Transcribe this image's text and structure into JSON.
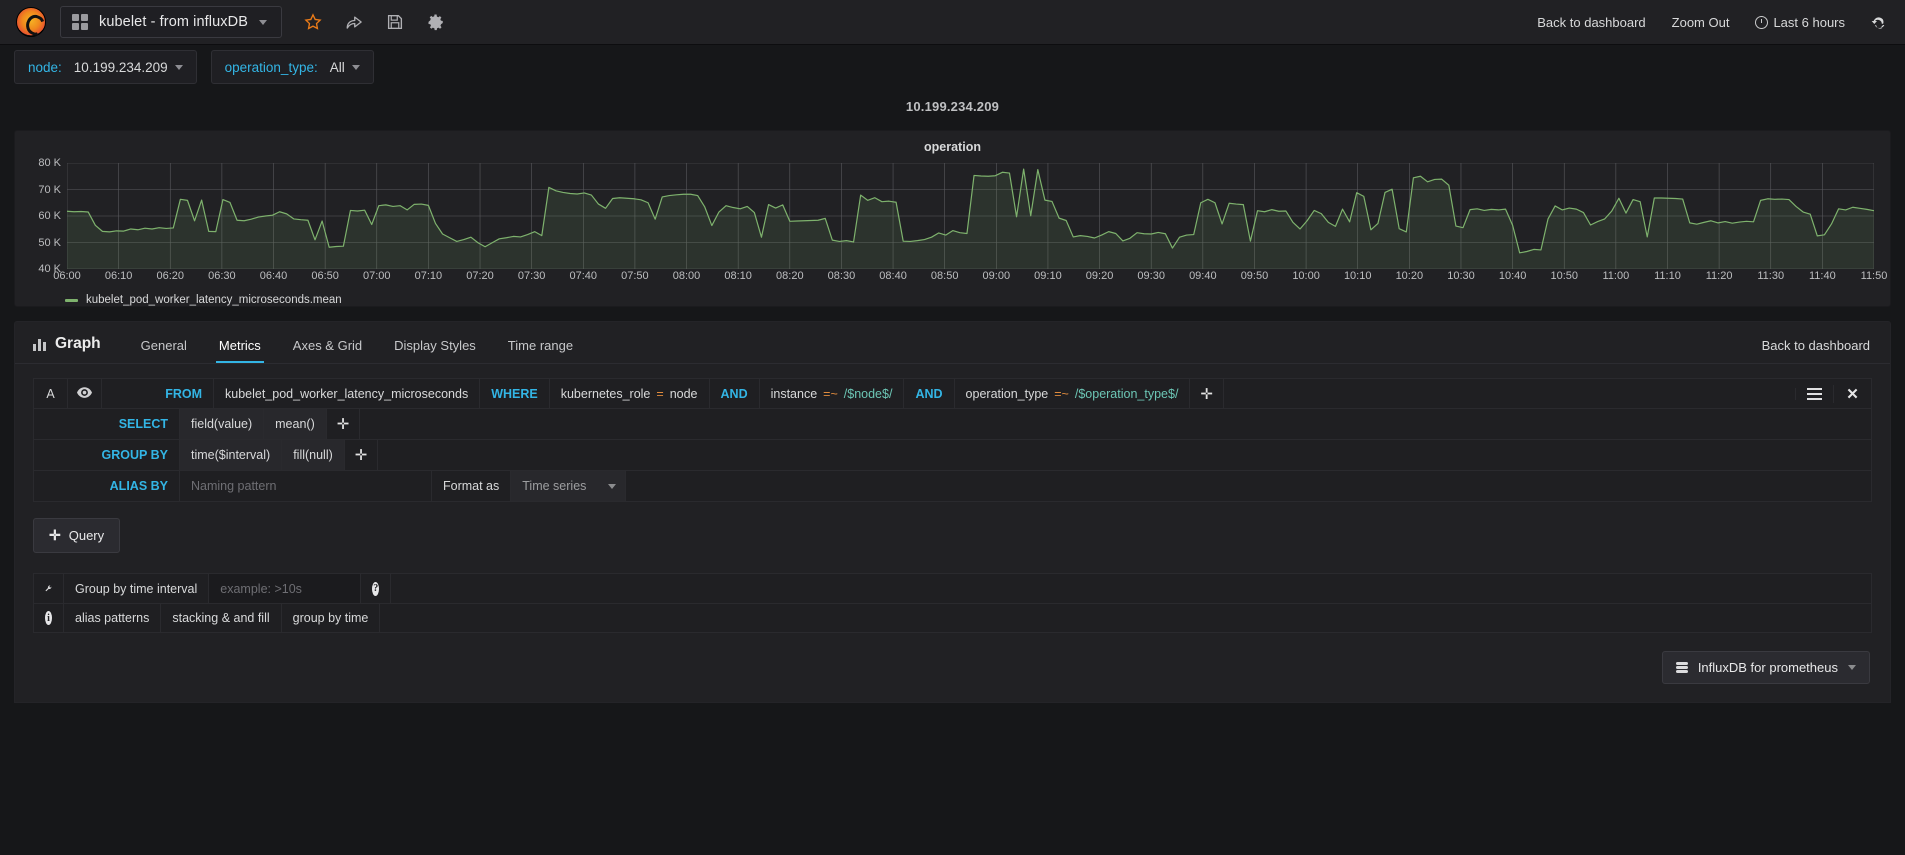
{
  "navbar": {
    "logo_icon": "grafana-logo-icon",
    "grid_icon": "grid-icon",
    "dashboard_title": "kubelet - from influxDB",
    "caret_icon": "chevron-down-icon",
    "icons": [
      {
        "name": "star-icon",
        "title": "Mark as favorite"
      },
      {
        "name": "share-icon",
        "title": "Share dashboard"
      },
      {
        "name": "save-icon",
        "title": "Save dashboard"
      },
      {
        "name": "gear-icon",
        "title": "Dashboard settings"
      }
    ],
    "back_to_dashboard": "Back to dashboard",
    "zoom_out": "Zoom Out",
    "time_range": "Last 6 hours",
    "clock_icon": "clock-icon",
    "refresh_icon": "refresh-icon"
  },
  "template_vars": [
    {
      "label": "node:",
      "value": "10.199.234.209",
      "caret_icon": "chevron-down-icon"
    },
    {
      "label": "operation_type:",
      "value": "All",
      "caret_icon": "chevron-down-icon"
    }
  ],
  "row_title": "10.199.234.209",
  "chart_data": {
    "type": "line",
    "title": "operation",
    "xlabel": "",
    "ylabel": "",
    "ylim": [
      40000,
      80000
    ],
    "grid": true,
    "legend_position": "bottom-left",
    "y_ticks": [
      "80 K",
      "70 K",
      "60 K",
      "50 K",
      "40 K"
    ],
    "y_tick_values": [
      80000,
      70000,
      60000,
      50000,
      40000
    ],
    "x_ticks": [
      "06:00",
      "06:10",
      "06:20",
      "06:30",
      "06:40",
      "06:50",
      "07:00",
      "07:10",
      "07:20",
      "07:30",
      "07:40",
      "07:50",
      "08:00",
      "08:10",
      "08:20",
      "08:30",
      "08:40",
      "08:50",
      "09:00",
      "09:10",
      "09:20",
      "09:30",
      "09:40",
      "09:50",
      "10:00",
      "10:10",
      "10:20",
      "10:30",
      "10:40",
      "10:50",
      "11:00",
      "11:10",
      "11:20",
      "11:30",
      "11:40",
      "11:50"
    ],
    "series": [
      {
        "name": "kubelet_pod_worker_latency_microseconds.mean",
        "color": "#7eb26d",
        "fill": true,
        "values": [
          61800,
          61600,
          61700,
          61500,
          56500,
          54200,
          54000,
          54400,
          54300,
          55100,
          54800,
          55400,
          55100,
          55600,
          55300,
          55500,
          66300,
          65900,
          58200,
          66000,
          54200,
          54100,
          66200,
          65100,
          58400,
          58200,
          58800,
          59600,
          60000,
          60300,
          61600,
          60800,
          58900,
          58600,
          58400,
          51000,
          58100,
          48200,
          48500,
          48600,
          62100,
          61900,
          62200,
          56800,
          63900,
          64200,
          63600,
          63900,
          62300,
          64400,
          64500,
          64000,
          57200,
          53200,
          51800,
          50400,
          51100,
          52000,
          49900,
          48400,
          49900,
          51400,
          51800,
          52300,
          52100,
          53000,
          54100,
          52600,
          70800,
          69500,
          68900,
          68500,
          68300,
          68700,
          67900,
          64500,
          62900,
          66600,
          66900,
          66700,
          66500,
          66100,
          65000,
          58800,
          67200,
          67700,
          68000,
          68200,
          68200,
          67700,
          63400,
          56400,
          61500,
          63900,
          63200,
          62700,
          63600,
          61300,
          52000,
          64300,
          63000,
          64200,
          58000,
          58100,
          58200,
          58300,
          58400,
          59100,
          50900,
          50400,
          50700,
          50200,
          67900,
          65900,
          66900,
          65400,
          65600,
          65200,
          50500,
          50400,
          50700,
          51100,
          52000,
          53600,
          52800,
          54500,
          53700,
          53400,
          75300,
          75100,
          75000,
          75200,
          76500,
          76200,
          59700,
          77700,
          60100,
          77500,
          66000,
          65500,
          59200,
          58300,
          52100,
          52600,
          52300,
          51700,
          52800,
          54100,
          53400,
          50600,
          51600,
          53700,
          53300,
          53200,
          53800,
          53300,
          47900,
          52000,
          52800,
          53000,
          65000,
          66300,
          65000,
          57000,
          64800,
          64500,
          64300,
          50500,
          62000,
          61600,
          62400,
          61800,
          61900,
          57600,
          55100,
          58200,
          62100,
          60900,
          57600,
          56100,
          62600,
          57800,
          68800,
          67400,
          54800,
          57200,
          68900,
          70100,
          55200,
          54000,
          74400,
          75000,
          72900,
          73800,
          73900,
          71600,
          56200,
          55600,
          62400,
          62700,
          62100,
          62500,
          62300,
          62600,
          56500,
          46100,
          46600,
          47400,
          47200,
          58900,
          63800,
          62300,
          63000,
          62600,
          61300,
          56600,
          57900,
          58900,
          61900,
          66700,
          61100,
          66200,
          65400,
          52100,
          66800,
          66800,
          66700,
          66600,
          66400,
          57400,
          56900,
          57600,
          58200,
          57400,
          57900,
          57300,
          57700,
          58000,
          57800,
          65900,
          66500,
          66300,
          66400,
          66200,
          63600,
          61500,
          60700,
          52500,
          52900,
          57000,
          62700,
          62300,
          63300,
          62900,
          62500,
          62000
        ]
      }
    ]
  },
  "editor": {
    "panel_type_label": "Graph",
    "panel_type_icon": "bar-chart-icon",
    "tabs": [
      {
        "label": "General",
        "active": false
      },
      {
        "label": "Metrics",
        "active": true
      },
      {
        "label": "Axes & Grid",
        "active": false
      },
      {
        "label": "Display Styles",
        "active": false
      },
      {
        "label": "Time range",
        "active": false
      }
    ],
    "back_to_dashboard": "Back to dashboard",
    "query": {
      "ref_id": "A",
      "eye_icon": "eye-icon",
      "from_label": "FROM",
      "measurement": "kubelet_pod_worker_latency_microseconds",
      "where_label": "WHERE",
      "conditions": [
        {
          "key": "kubernetes_role",
          "op": "=",
          "value": "node",
          "op_class": "plain"
        },
        {
          "prefix": "AND",
          "key": "instance",
          "op": "=~",
          "value": "/$node$/",
          "op_class": "regex"
        },
        {
          "prefix": "AND",
          "key": "operation_type",
          "op": "=~",
          "value": "/$operation_type$/",
          "op_class": "regex"
        }
      ],
      "add_icon": "plus-icon",
      "menu_icon": "hamburger-icon",
      "remove_icon": "close-icon",
      "select_label": "SELECT",
      "select_parts": [
        "field(value)",
        "mean()"
      ],
      "group_by_label": "GROUP BY",
      "group_by_parts": [
        "time($interval)",
        "fill(null)"
      ],
      "alias_by_label": "ALIAS BY",
      "alias_placeholder": "Naming pattern",
      "alias_value": "",
      "format_as_label": "Format as",
      "format_as_value": "Time series"
    },
    "add_query_button": "Query",
    "add_query_icon": "plus-icon",
    "options": {
      "wrench_icon": "wrench-icon",
      "group_by_time_interval_label": "Group by time interval",
      "group_by_time_interval_placeholder": "example: >10s",
      "group_by_time_interval_value": "",
      "help_icon": "question-mark-icon",
      "info_icon": "info-icon",
      "help_links": [
        "alias patterns",
        "stacking & and fill",
        "group by time"
      ]
    },
    "datasource": {
      "icon": "database-icon",
      "name": "InfluxDB for prometheus",
      "caret_icon": "chevron-down-icon"
    }
  }
}
